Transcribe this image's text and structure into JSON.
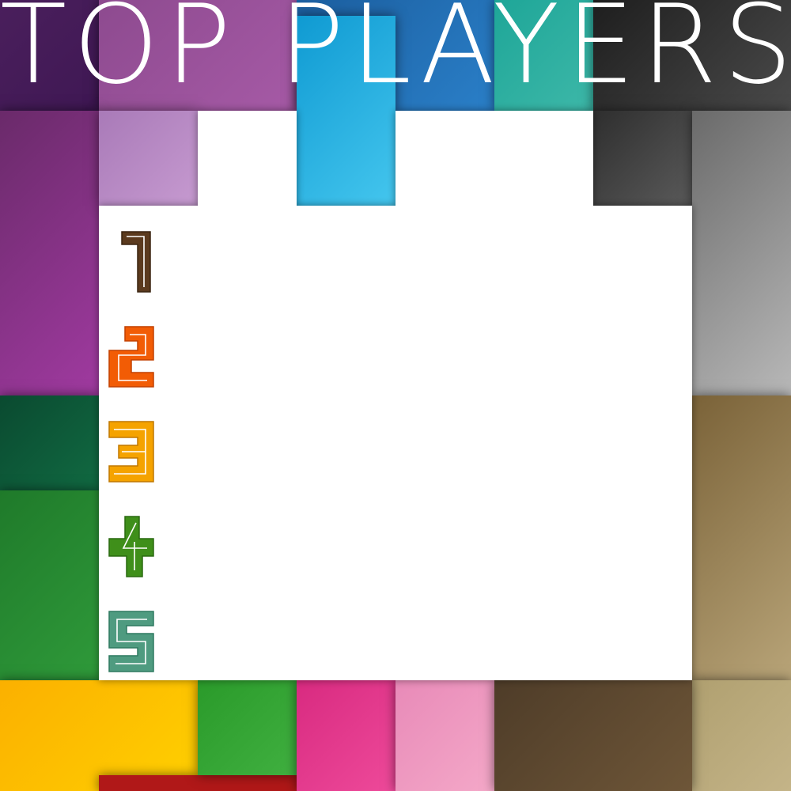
{
  "title": "TOP PLAYERS",
  "ranks": [
    {
      "label": "1",
      "color": "#5b3a1e",
      "light": "#8a5a30"
    },
    {
      "label": "2",
      "color": "#f25c05",
      "light": "#ff8a3a"
    },
    {
      "label": "3",
      "color": "#f5a300",
      "light": "#ffc040"
    },
    {
      "label": "4",
      "color": "#3f8f1a",
      "light": "#6cc03a"
    },
    {
      "label": "5",
      "color": "#4f9b80",
      "light": "#7fcfb0"
    }
  ],
  "palette": {
    "panel": "#ffffff",
    "purple_dark": "#4a1f5c",
    "purple": "#9b3a96",
    "mauve": "#b783c0",
    "cyan": "#1fa8dc",
    "teal": "#23a89a",
    "gray_dark": "#3b3b3b",
    "gray": "#8a8a8a",
    "green_dark": "#0d5a38",
    "green": "#2f8f2f",
    "yellow": "#fbb800",
    "magenta": "#e0348a",
    "pink": "#ec8ab8",
    "brown": "#5e4a30",
    "tan": "#a88a58"
  }
}
